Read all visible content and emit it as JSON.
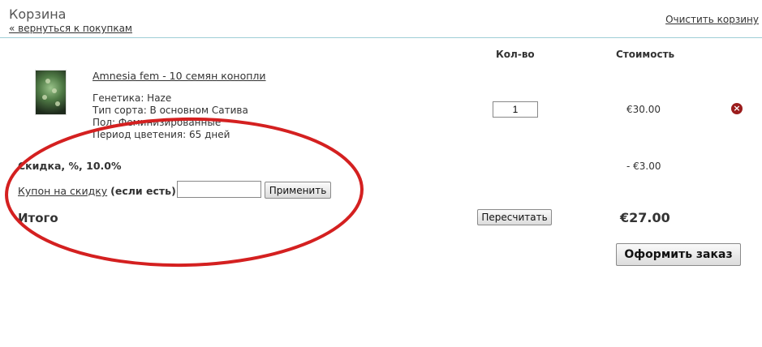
{
  "header": {
    "title": "Корзина",
    "back_link": "« вернуться к покупкам",
    "clear_link": "Очистить корзину"
  },
  "columns": {
    "qty": "Кол-во",
    "cost": "Стоимость"
  },
  "product": {
    "name": "Amnesia fem - 10 семян конопли",
    "specs": [
      "Генетика: Haze",
      "Тип сорта: В основном Сатива",
      "Пол: Феминизированные",
      "Период цветения: 65 дней"
    ],
    "quantity": "1",
    "price": "€30.00"
  },
  "discount": {
    "label": "Скидка, %, 10.0%",
    "value": "- €3.00"
  },
  "coupon": {
    "link": "Купон на скидку",
    "suffix": "(если есть):",
    "value": "",
    "apply_label": "Применить"
  },
  "total": {
    "label": "Итого",
    "value": "€27.00",
    "recalc_label": "Пересчитать",
    "checkout_label": "Оформить заказ"
  },
  "colors": {
    "divider": "#9fcfd6",
    "annotation": "#d42020",
    "remove_icon": "#9b1c1c"
  }
}
